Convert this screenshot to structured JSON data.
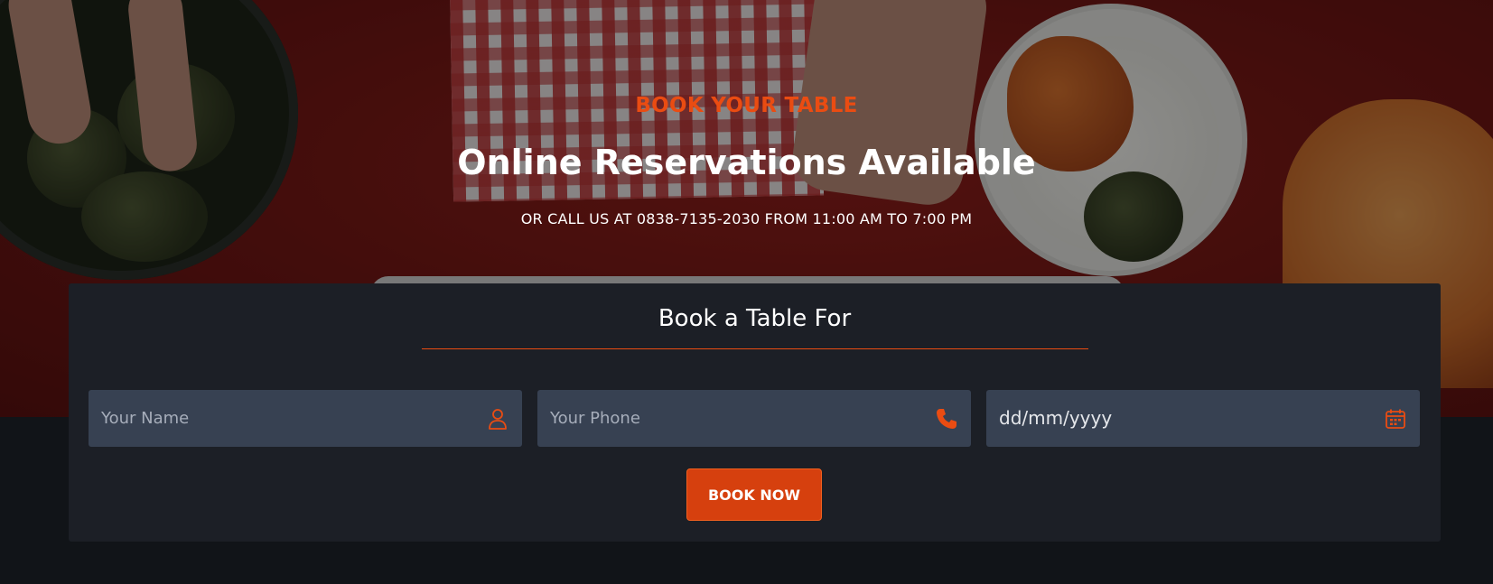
{
  "hero": {
    "eyebrow": "BOOK YOUR TABLE",
    "headline": "Online Reservations Available",
    "subline": "OR CALL US AT 0838-7135-2030 FROM 11:00 AM TO 7:00 PM"
  },
  "booking": {
    "title": "Book a Table For",
    "name_placeholder": "Your Name",
    "phone_placeholder": "Your Phone",
    "date_value": "dd/mm/yyyy",
    "submit_label": "BOOK NOW"
  },
  "icons": {
    "name": "user-icon",
    "phone": "phone-icon",
    "date": "calendar-icon"
  },
  "colors": {
    "accent": "#ea4c12",
    "panel": "#1c1f26",
    "field": "#374152",
    "page": "#111418"
  }
}
